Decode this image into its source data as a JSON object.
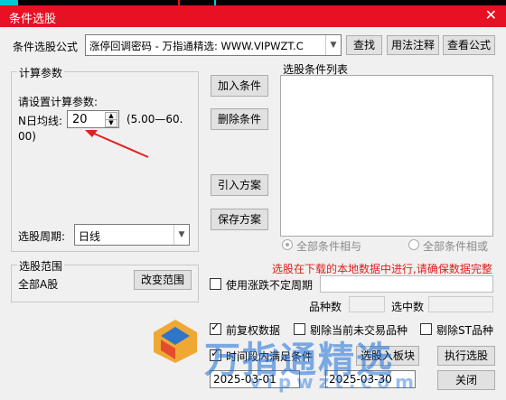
{
  "window": {
    "title": "条件选股",
    "close_glyph": "✕"
  },
  "formula": {
    "label": "条件选股公式",
    "value": "涨停回调密码 - 万指通精选: WWW.VIPWZT.C",
    "find_button": "查找",
    "usage_button": "用法注释",
    "view_button": "查看公式"
  },
  "params": {
    "group_title": "计算参数",
    "prompt": "请设置计算参数:",
    "n_label": "N日均线:",
    "n_value": "20",
    "range_line1": "(5.00—60.",
    "range_line2": "00)"
  },
  "period": {
    "label": "选股周期:",
    "value": "日线"
  },
  "conditions": {
    "add_button": "加入条件",
    "delete_button": "删除条件",
    "import_button": "引入方案",
    "save_button": "保存方案",
    "list_title": "选股条件列表",
    "radio_and": "全部条件相与",
    "radio_or": "全部条件相或"
  },
  "warning_text": "选股在下载的本地数据中进行,请确保数据完整",
  "warning_color": "#e02020",
  "scope": {
    "group_title": "选股范围",
    "value": "全部A股",
    "change_button": "改变范围"
  },
  "options": {
    "use_limit_label": "使用涨跌不定周期",
    "stock_count_label": "品种数",
    "selected_label": "选中数",
    "adjust_label": "前复权数据",
    "exclude_untraded_label": "剔除当前未交易品种",
    "exclude_st_label": "剔除ST品种",
    "time_range_label": "时间段内满足条件",
    "date_from": "2025-03-01",
    "date_to": "2025-03-30",
    "to_block_button": "选股入板块",
    "execute_button": "执行选股",
    "close_button": "关闭"
  },
  "watermark": {
    "text_cn": "万指通精选",
    "text_url": "vipwzt.com"
  }
}
